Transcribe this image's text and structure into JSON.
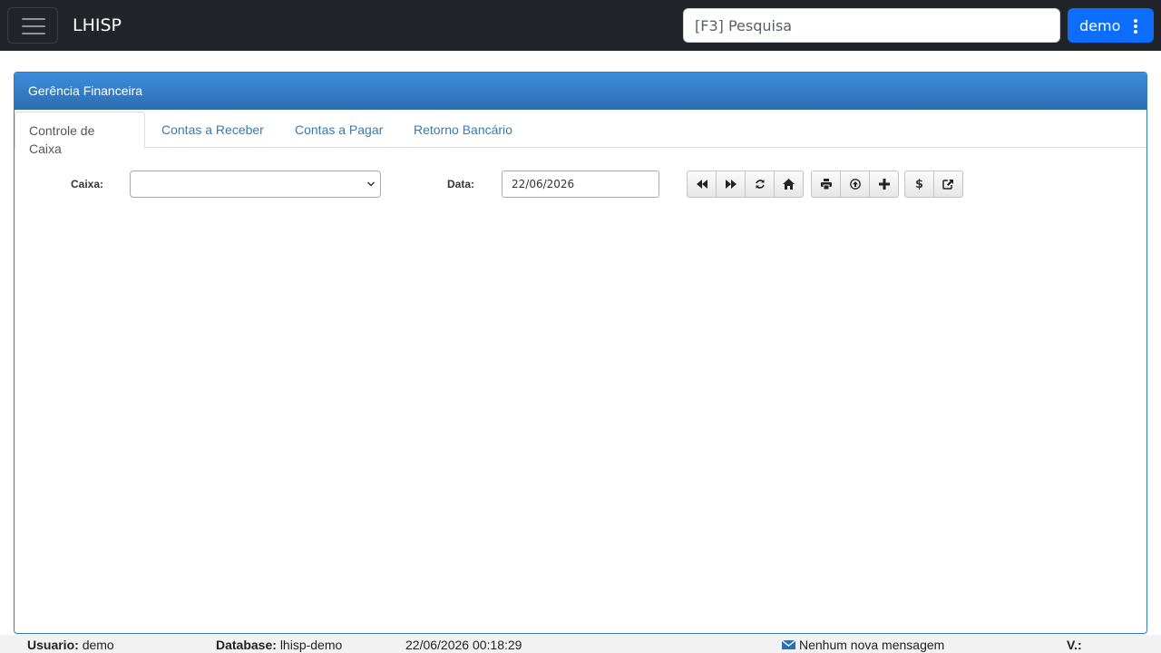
{
  "navbar": {
    "brand": "LHISP",
    "search_placeholder": "[F3] Pesquisa",
    "user_label": "demo"
  },
  "panel": {
    "title": "Gerência Financeira",
    "tabs": [
      {
        "label": "Controle de Caixa",
        "active": true
      },
      {
        "label": "Contas a Receber",
        "active": false
      },
      {
        "label": "Contas a Pagar",
        "active": false
      },
      {
        "label": "Retorno Bancário",
        "active": false
      }
    ]
  },
  "form": {
    "caixa_label": "Caixa:",
    "caixa_value": "",
    "data_label": "Data:",
    "data_value": "22/06/2026"
  },
  "toolbar": {
    "icons": [
      "backward-icon",
      "forward-icon",
      "refresh-icon",
      "home-icon",
      "print-icon",
      "upload-icon",
      "plus-icon",
      "dollar-icon",
      "export-icon"
    ],
    "dollar_symbol": "$"
  },
  "status": {
    "usuario_label": "Usuario:",
    "usuario_value": "demo",
    "database_label": "Database:",
    "database_value": "lhisp-demo",
    "datetime": "22/06/2026 00:18:29",
    "messages": "Nenhum nova mensagem",
    "version_label": "V.:"
  },
  "colors": {
    "navbar_bg": "#212529",
    "primary_button": "#0d6efd",
    "panel_heading": "#337ab7",
    "tab_link": "#337ab7"
  }
}
